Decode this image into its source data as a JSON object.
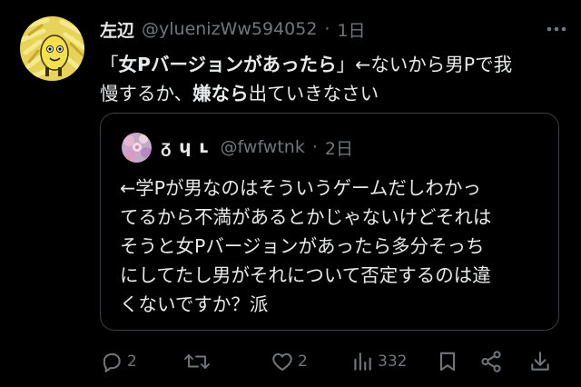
{
  "tweet": {
    "author_name": "左辺",
    "handle": "@yluenizWw594052",
    "separator": "·",
    "time": "1日",
    "text_line1_open": "「",
    "text_line1_bold": "女Pバージョンがあったら",
    "text_line1_rest": "」←ないから男Pで我",
    "text_line2_pre": "慢するか、",
    "text_line2_bold": "嫌なら",
    "text_line2_post": "出ていきなさい"
  },
  "quote": {
    "author_name": "ᵹ ɥ ʟ",
    "handle": "@fwfwtnk",
    "separator": "·",
    "time": "2日",
    "lines": [
      "←学Pが男なのはそういうゲームだしわかっ",
      "てるから不満があるとかじゃないけどそれは",
      "そうと女Pバージョンがあったら多分そっち",
      "にしてたし男がそれについて否定するのは違",
      "くないですか？派"
    ]
  },
  "actions": {
    "replies": "2",
    "retweets": "",
    "likes": "2",
    "views": "332"
  },
  "icons": {
    "avatar": "fries-character-avatar",
    "quote_avatar": "pink-floral-avatar",
    "more": "more-icon",
    "reply": "reply-icon",
    "retweet": "retweet-icon",
    "like": "heart-icon",
    "views": "views-icon",
    "bookmark": "bookmark-icon",
    "share": "share-icon",
    "download": "download-icon"
  },
  "colors": {
    "background": "#000000",
    "text": "#e7e9ea",
    "muted": "#71767b",
    "border": "#3a3d41"
  }
}
